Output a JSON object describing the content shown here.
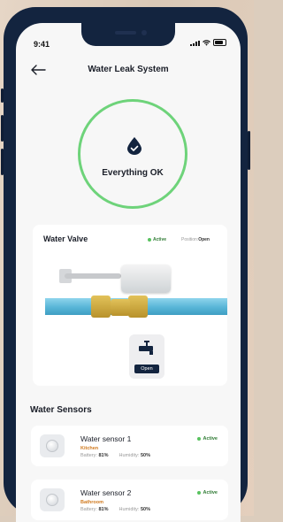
{
  "status_bar": {
    "time": "9:41"
  },
  "header": {
    "title": "Water Leak System",
    "back_icon": "arrow-left-icon"
  },
  "overview": {
    "status_text": "Everything OK",
    "icon": "water-drop-check-icon",
    "ring_color": "#6ed37a"
  },
  "valve": {
    "title": "Water Valve",
    "status": "Active",
    "position_label": "Position:",
    "position_value": "Open",
    "button_label": "Open",
    "button_icon": "tap-icon"
  },
  "sensors": {
    "title": "Water Sensors",
    "items": [
      {
        "name": "Water sensor 1",
        "location": "Kitchen",
        "battery_label": "Battery:",
        "battery": "81%",
        "humidity_label": "Humidity:",
        "humidity": "50%",
        "status": "Active"
      },
      {
        "name": "Water sensor 2",
        "location": "Bathroom",
        "battery_label": "Battery:",
        "battery": "81%",
        "humidity_label": "Humidity:",
        "humidity": "50%",
        "status": "Active"
      }
    ]
  },
  "colors": {
    "frame": "#13243f",
    "active_green": "#58c25e",
    "location_orange": "#d07a1f",
    "pipe_blue": "#58b5d7"
  }
}
